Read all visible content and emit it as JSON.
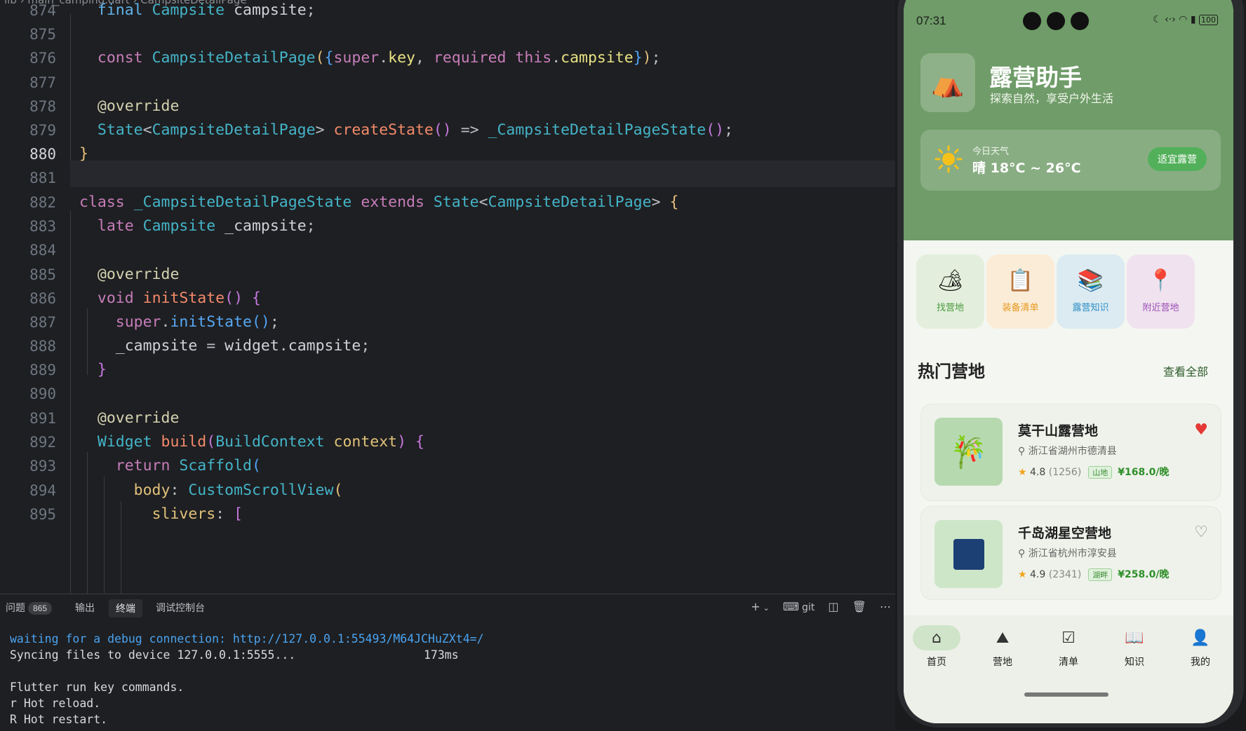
{
  "editor": {
    "breadcrumb": "lib › main_camping.dart › CampsiteDetailPage",
    "line_numbers": [
      "874",
      "875",
      "876",
      "877",
      "878",
      "879",
      "880",
      "881",
      "882",
      "883",
      "884",
      "885",
      "886",
      "887",
      "888",
      "889",
      "890",
      "891",
      "892",
      "893",
      "894",
      "895"
    ],
    "current_line": "880"
  },
  "panel": {
    "tabs": [
      {
        "label": "问题",
        "badge": "865"
      },
      {
        "label": "输出"
      },
      {
        "label": "终端"
      },
      {
        "label": "调试控制台"
      }
    ],
    "tools": {
      "add": "+",
      "chevron": "⌄",
      "git": "git"
    },
    "terminal": {
      "line1": "waiting for a debug connection: http://127.0.0.1:55493/M64JCHuZXt4=/",
      "line2": "Syncing files to device 127.0.0.1:5555...",
      "line2_time": "173ms",
      "line3": "Flutter run key commands.",
      "line4": "r Hot reload.",
      "line5": "R Hot restart."
    }
  },
  "phone": {
    "status_time": "07:31",
    "battery": "100",
    "app_title": "露营助手",
    "app_subtitle": "探索自然，享受户外生活",
    "weather": {
      "label": "今日天气",
      "temp": "晴 18°C ~ 26°C",
      "badge": "适宜露营"
    },
    "quick": [
      {
        "label": "找营地",
        "icon": "🏕",
        "color": "#4a9a3f",
        "bg": "#e3efdc"
      },
      {
        "label": "装备清单",
        "icon": "📋",
        "color": "#e69a1e",
        "bg": "#fbecd8"
      },
      {
        "label": "露营知识",
        "icon": "📚",
        "color": "#2e8fc6",
        "bg": "#dcebf1"
      },
      {
        "label": "附近营地",
        "icon": "📍",
        "color": "#9c4fb6",
        "bg": "#f0e2ef"
      }
    ],
    "section_title": "热门营地",
    "see_all": "查看全部",
    "campsites": [
      {
        "name": "莫干山露营地",
        "location": "浙江省湖州市德清县",
        "rating": "4.8",
        "reviews": "(1256)",
        "tag": "山地",
        "price": "¥168.0/晚",
        "favorite": true
      },
      {
        "name": "千岛湖星空营地",
        "location": "浙江省杭州市淳安县",
        "rating": "4.9",
        "reviews": "(2341)",
        "tag": "湖畔",
        "price": "¥258.0/晚",
        "favorite": false
      }
    ],
    "nav": [
      {
        "label": "首页",
        "icon": "⌂"
      },
      {
        "label": "营地",
        "icon": "⛰"
      },
      {
        "label": "清单",
        "icon": "☑"
      },
      {
        "label": "知识",
        "icon": "📖"
      },
      {
        "label": "我的",
        "icon": "👤"
      }
    ]
  }
}
